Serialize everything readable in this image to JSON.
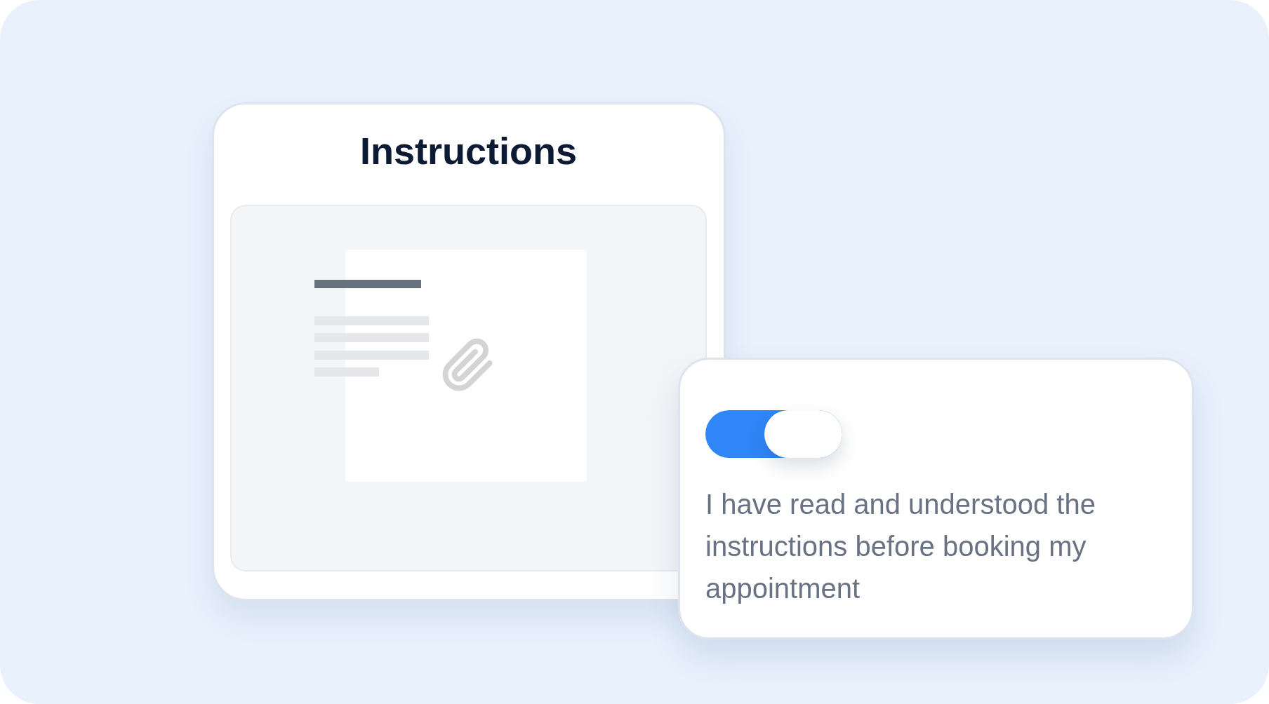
{
  "instructions_card": {
    "title": "Instructions"
  },
  "consent_card": {
    "toggle": {
      "on": true
    },
    "text": "I have read and understood the instructions before booking my appointment"
  }
}
